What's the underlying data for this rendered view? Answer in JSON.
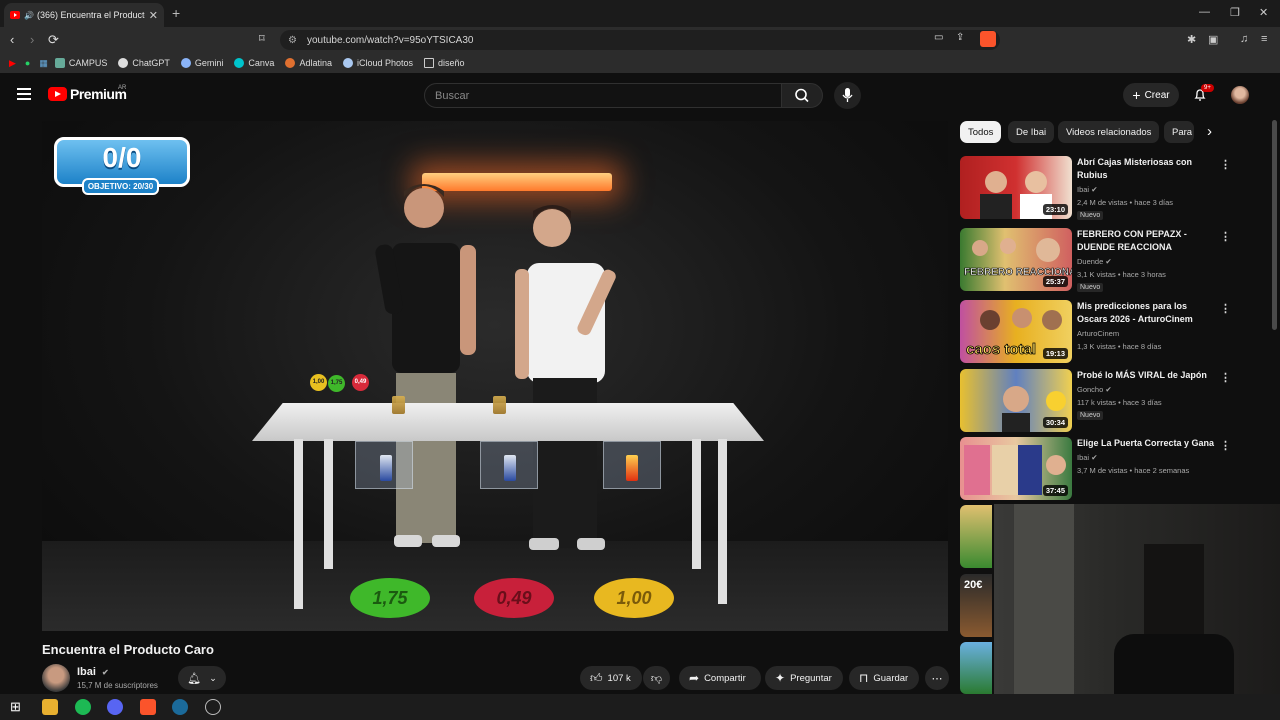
{
  "browser": {
    "tab_title": "(366) Encuentra el Producto C",
    "new_tab_label": "+",
    "url": "youtube.com/watch?v=95oYTSICA30",
    "bookmarks": [
      "CAMPUS",
      "ChatGPT",
      "Gemini",
      "Canva",
      "Adlatina",
      "iCloud Photos",
      "diseño"
    ]
  },
  "header": {
    "brand": "Premium",
    "country": "AR",
    "search_placeholder": "Buscar",
    "create_label": "Crear",
    "notif_badge": "9+"
  },
  "video": {
    "score": "0/0",
    "objetivo": "OBJETIVO: 20/30",
    "prices": [
      "1,75",
      "0,49",
      "1,00"
    ],
    "balls": [
      "1,00",
      "1,75",
      "0,49"
    ]
  },
  "below": {
    "title": "Encuentra el Producto Caro",
    "channel": "Ibai",
    "subscribers": "15,7 M de suscriptores",
    "likes": "107 k",
    "share": "Compartir",
    "ask": "Preguntar",
    "save": "Guardar"
  },
  "sidebar": {
    "chips": [
      "Todos",
      "De Ibai",
      "Videos relacionados",
      "Para"
    ],
    "recs": [
      {
        "title": "Abrí Cajas Misteriosas con Rubius",
        "channel": "Ibai",
        "stats": "2,4 M de vistas • hace 3 días",
        "duration": "23:10",
        "badge": "Nuevo"
      },
      {
        "title": "FEBRERO CON PEPAZX - DUENDE REACCIONA",
        "channel": "Duende",
        "stats": "3,1 K vistas • hace 3 horas",
        "duration": "25:37",
        "badge": "Nuevo"
      },
      {
        "title": "Mis predicciones para los Oscars 2026 - ArturoCinem",
        "channel": "ArturoCinem",
        "stats": "1,3 K vistas • hace 8 días",
        "duration": "19:13",
        "badge": ""
      },
      {
        "title": "Probé lo MÁS VIRAL de Japón",
        "channel": "Goncho",
        "stats": "117 k vistas • hace 3 días",
        "duration": "30:34",
        "badge": "Nuevo"
      },
      {
        "title": "Elige La Puerta Correcta y Gana",
        "channel": "Ibai",
        "stats": "3,7 M de vistas • hace 2 semanas",
        "duration": "37:45",
        "badge": ""
      }
    ],
    "thumb_texts": [
      "FEBRERO REACCIONANDO",
      "caos total",
      "20€"
    ]
  },
  "colors": {
    "background": "#0f0f0f",
    "youtube_red": "#ff0000",
    "price_green": "#3fb82a",
    "price_red": "#c8203a",
    "price_yellow": "#e8b820"
  }
}
